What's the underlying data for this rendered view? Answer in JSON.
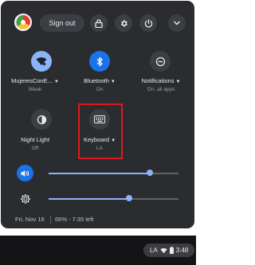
{
  "colors": {
    "panel_bg": "#2b2c30",
    "accent": "#8ab4f8",
    "active_tile": "#1a73e8",
    "highlight_box": "#e4171e"
  },
  "header": {
    "sign_out_label": "Sign out",
    "icons": [
      "avatar",
      "lock-icon",
      "gear-icon",
      "power-icon",
      "chevron-down-icon"
    ]
  },
  "tiles": [
    {
      "label": "MujeresConE...",
      "sub": "Weak",
      "icon": "wifi-icon",
      "active": true
    },
    {
      "label": "Bluetooth",
      "sub": "On",
      "icon": "bluetooth-icon",
      "active": true
    },
    {
      "label": "Notifications",
      "sub": "On, all apps",
      "icon": "notifications-icon",
      "active": false
    },
    {
      "label": "Night Light",
      "sub": "Off",
      "icon": "night-light-icon",
      "active": false
    },
    {
      "label": "Keyboard",
      "sub": "LA",
      "icon": "keyboard-icon",
      "active": false
    }
  ],
  "sliders": {
    "volume": {
      "icon": "volume-icon",
      "level": 0.78
    },
    "brightness": {
      "icon": "brightness-icon",
      "level": 0.62
    }
  },
  "footer": {
    "date": "Fri, Nov 16",
    "battery": "66% - 7:35 left"
  },
  "shelf": {
    "ime": "LA",
    "time": "3:48"
  }
}
